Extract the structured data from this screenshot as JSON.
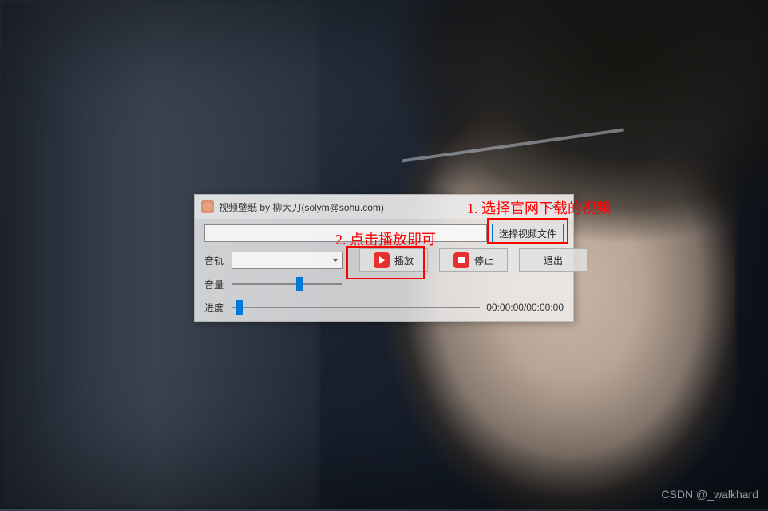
{
  "dialog": {
    "title": "视频壁纸  by 柳大刀(solym@sohu.com)",
    "close_label": "×",
    "path_value": "",
    "select_file_label": "选择视频文件",
    "track_label": "音轨",
    "track_value": "",
    "volume_label": "音量",
    "play_label": "播放",
    "stop_label": "停止",
    "exit_label": "退出",
    "progress_label": "进度",
    "time_display": "00:00:00/00:00:00",
    "volume_percent": 62,
    "progress_percent": 2
  },
  "annotations": {
    "step1": "1. 选择官网下载的视频",
    "step2": "2. 点击播放即可"
  },
  "watermark": "CSDN @_walkhard",
  "colors": {
    "accent_red": "#ff0000",
    "button_highlight": "#0078d7",
    "icon_red": "#e63030"
  }
}
